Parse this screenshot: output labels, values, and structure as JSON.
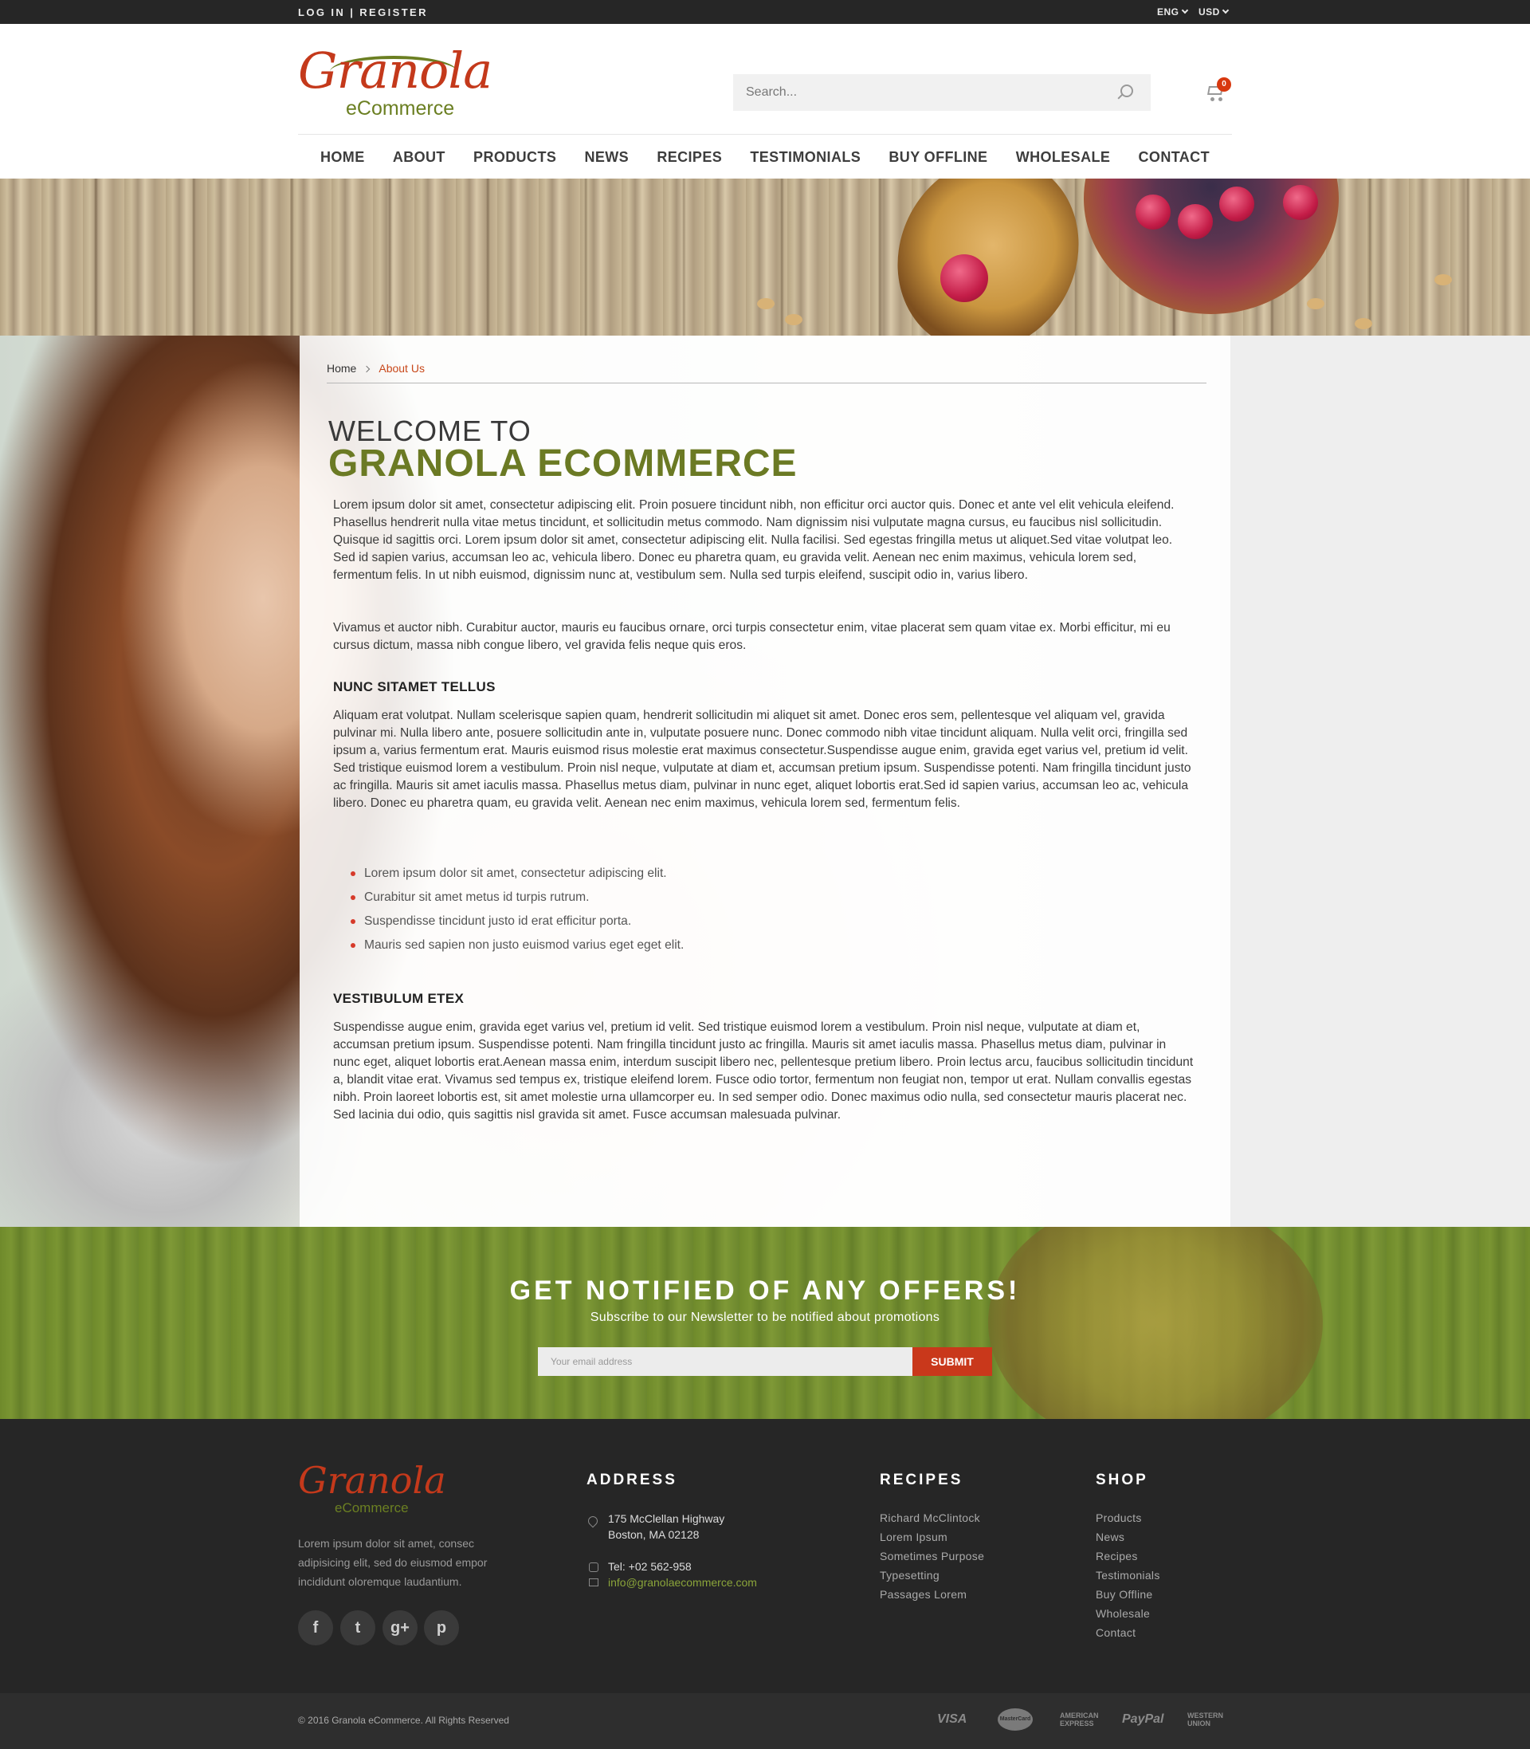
{
  "topbar": {
    "login": "LOG IN",
    "sep": "|",
    "register": "REGISTER",
    "language": "ENG",
    "currency": "USD"
  },
  "header": {
    "logo": {
      "script": "Granola",
      "sub": "eCommerce"
    },
    "search_placeholder": "Search...",
    "cart_count": "0"
  },
  "nav": {
    "items": [
      "HOME",
      "ABOUT",
      "PRODUCTS",
      "NEWS",
      "RECIPES",
      "TESTIMONIALS",
      "BUY OFFLINE",
      "WHOLESALE",
      "CONTACT"
    ]
  },
  "breadcrumb": {
    "home": "Home",
    "current": "About Us"
  },
  "page": {
    "welcome_line1": "WELCOME TO",
    "welcome_line2": "GRANOLA ECOMMERCE",
    "para1": "Lorem ipsum dolor sit amet, consectetur adipiscing elit. Proin posuere tincidunt nibh, non efficitur orci auctor quis. Donec et ante vel elit vehicula eleifend. Phasellus hendrerit nulla vitae metus tincidunt, et sollicitudin metus commodo. Nam dignissim nisi vulputate magna cursus, eu faucibus nisl sollicitudin. Quisque id sagittis orci. Lorem ipsum dolor sit amet, consectetur adipiscing elit. Nulla facilisi. Sed egestas fringilla metus ut aliquet.Sed vitae volutpat leo. Sed id sapien varius, accumsan leo ac, vehicula libero. Donec eu pharetra quam, eu gravida velit. Aenean nec enim maximus, vehicula lorem sed, fermentum felis. In ut nibh euismod, dignissim nunc at, vestibulum sem. Nulla sed turpis eleifend, suscipit odio in, varius libero.",
    "para2": "Vivamus et auctor nibh. Curabitur auctor, mauris eu faucibus ornare, orci turpis consectetur enim, vitae placerat sem quam vitae ex. Morbi efficitur, mi eu cursus dictum, massa nibh congue libero, vel gravida felis neque quis eros.",
    "subhead1": "NUNC SITAMET TELLUS",
    "para3": "Aliquam erat volutpat. Nullam scelerisque sapien quam, hendrerit sollicitudin mi aliquet sit amet. Donec eros sem, pellentesque vel aliquam vel, gravida pulvinar mi. Nulla libero ante, posuere sollicitudin ante in, vulputate posuere nunc. Donec commodo nibh vitae tincidunt aliquam. Nulla velit orci, fringilla sed ipsum a, varius fermentum erat. Mauris euismod risus molestie erat maximus consectetur.Suspendisse augue enim, gravida eget varius vel, pretium id velit. Sed tristique euismod lorem a vestibulum. Proin nisl neque, vulputate at diam et, accumsan pretium ipsum. Suspendisse potenti. Nam fringilla tincidunt justo ac fringilla. Mauris sit amet iaculis massa. Phasellus metus diam, pulvinar in nunc eget, aliquet lobortis erat.Sed id sapien varius, accumsan leo ac, vehicula libero. Donec eu pharetra quam, eu gravida velit. Aenean nec enim maximus, vehicula lorem sed, fermentum felis.",
    "bullets": [
      "Lorem ipsum dolor sit amet, consectetur adipiscing elit.",
      "Curabitur sit amet metus id turpis rutrum.",
      "Suspendisse tincidunt justo id erat efficitur porta.",
      "Mauris sed sapien non justo euismod varius eget eget elit."
    ],
    "subhead2": "VESTIBULUM ETEX",
    "para4": "Suspendisse augue enim, gravida eget varius vel, pretium id velit. Sed tristique euismod lorem a vestibulum. Proin nisl neque, vulputate at diam et, accumsan pretium ipsum. Suspendisse potenti. Nam fringilla tincidunt justo ac fringilla. Mauris sit amet iaculis massa. Phasellus metus diam, pulvinar in nunc eget, aliquet lobortis erat.Aenean massa enim, interdum suscipit libero nec, pellentesque pretium libero. Proin lectus arcu, faucibus sollicitudin tincidunt a, blandit vitae erat. Vivamus sed tempus ex, tristique eleifend lorem. Fusce odio tortor, fermentum non feugiat non, tempor ut erat. Nullam convallis egestas nibh. Proin laoreet lobortis est, sit amet molestie urna ullamcorper eu. In sed semper odio. Donec maximus odio nulla, sed consectetur mauris placerat nec. Sed lacinia dui odio, quis sagittis nisl gravida sit amet. Fusce accumsan malesuada pulvinar."
  },
  "newsletter": {
    "title": "GET NOTIFIED OF ANY OFFERS!",
    "subtitle": "Subscribe to our Newsletter to be notified about promotions",
    "placeholder": "Your email address",
    "button": "SUBMIT"
  },
  "footer": {
    "logo": {
      "script": "Granola",
      "sub": "eCommerce"
    },
    "about": "Lorem ipsum dolor sit amet, consec adipisicing elit, sed do eiusmod empor incididunt oloremque laudantium.",
    "social": {
      "facebook": "f",
      "twitter": "t",
      "googleplus": "g+",
      "pinterest": "p"
    },
    "address_title": "ADDRESS",
    "address_line1": "175 McClellan Highway",
    "address_line2": "Boston, MA 02128",
    "phone": "Tel: +02 562-958",
    "email": "info@granolaecommerce.com",
    "recipes_title": "RECIPES",
    "recipes": [
      "Richard McClintock",
      "Lorem Ipsum",
      "Sometimes Purpose",
      "Typesetting",
      "Passages  Lorem"
    ],
    "shop_title": "SHOP",
    "shop": [
      "Products",
      "News",
      "Recipes",
      "Testimonials",
      "Buy Offline",
      "Wholesale",
      "Contact"
    ],
    "copyright": "© 2016 Granola eCommerce. All Rights Reserved",
    "payments": {
      "visa": "VISA",
      "mastercard": "MasterCard",
      "amex_1": "AMERICAN",
      "amex_2": "EXPRESS",
      "paypal": "PayPal",
      "wu_1": "WESTERN",
      "wu_2": "UNION"
    }
  },
  "colors": {
    "brand_red": "#c4391b",
    "brand_green": "#6b7f22",
    "dark": "#262626"
  }
}
